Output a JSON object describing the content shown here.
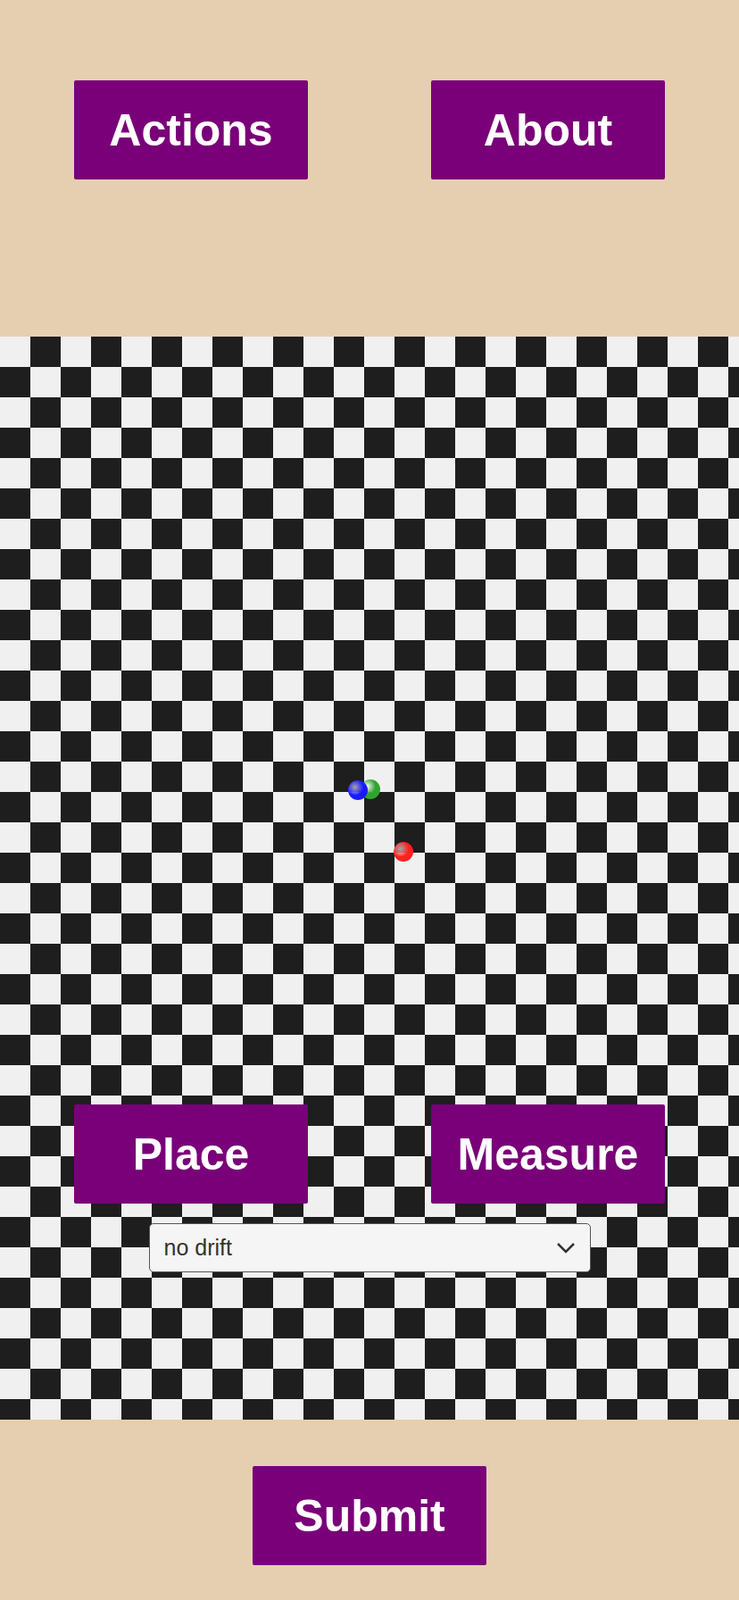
{
  "top_buttons": [
    {
      "label": "Actions"
    },
    {
      "label": "About"
    }
  ],
  "markers": [
    {
      "color": "#2fa52f"
    },
    {
      "color": "#1a1aff"
    },
    {
      "color": "#ff2020"
    }
  ],
  "action_buttons": [
    {
      "label": "Place"
    },
    {
      "label": "Measure"
    }
  ],
  "dropdown": {
    "value": "no drift"
  },
  "submit": {
    "label": "Submit"
  }
}
